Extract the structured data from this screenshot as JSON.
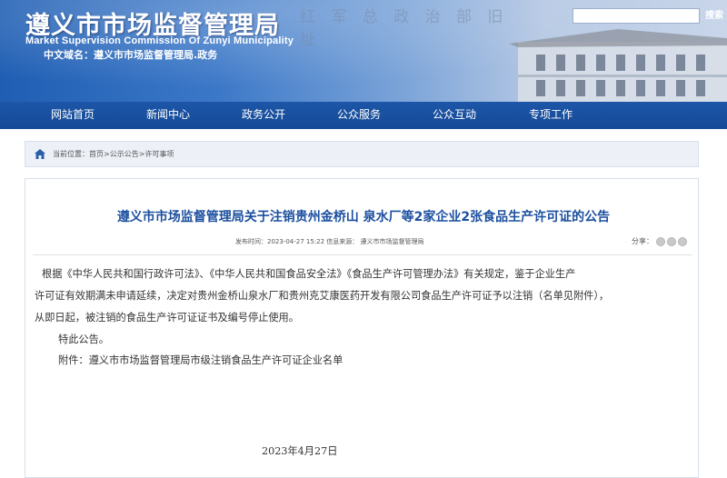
{
  "header": {
    "site_title": "遵义市市场监督管理局",
    "site_title_en": "Market Supervision Commission Of Zunyi Municipality",
    "chinese_domain": "中文域名：遵义市市场监督管理局.政务",
    "calligraphy": "红 军 总 政 治 部 旧 址",
    "search_placeholder": "",
    "search_button": "搜索"
  },
  "nav": {
    "items": [
      "网站首页",
      "新闻中心",
      "政务公开",
      "公众服务",
      "公众互动",
      "专项工作"
    ]
  },
  "breadcrumb": {
    "prefix": "当前位置：",
    "path": "首页>公示公告>许可事项"
  },
  "article": {
    "title": "遵义市市场监督管理局关于注销贵州金桥山 泉水厂等2家企业2张食品生产许可证的公告",
    "meta": "发布时间：2023-04-27 15:22 信息来源：  遵义市市场监督管理局",
    "share_label": "分享：",
    "share_icons": [
      "wechat-icon",
      "weibo-icon",
      "qq-icon"
    ],
    "paragraph_lines": [
      "根据《中华人民共和国行政许可法》、《中华人民共和国食品安全法》《食品生产许可管理办法》有关规定，鉴于企业生产",
      "许可证有效期满未申请延续，决定对贵州金桥山泉水厂和贵州克艾康医药开发有限公司食品生产许可证予以注销（名单见附件），",
      "从即日起，被注销的食品生产许可证证书及编号停止使用。"
    ],
    "notice": "特此公告。",
    "attachment": "附件：遵义市市场监督管理局市级注销食品生产许可证企业名单",
    "date": "2023年4月27日"
  },
  "colors": {
    "nav_bg": "#1a52a2",
    "title_blue": "#1b4f9f",
    "crumb_bg": "#edf1f7"
  }
}
